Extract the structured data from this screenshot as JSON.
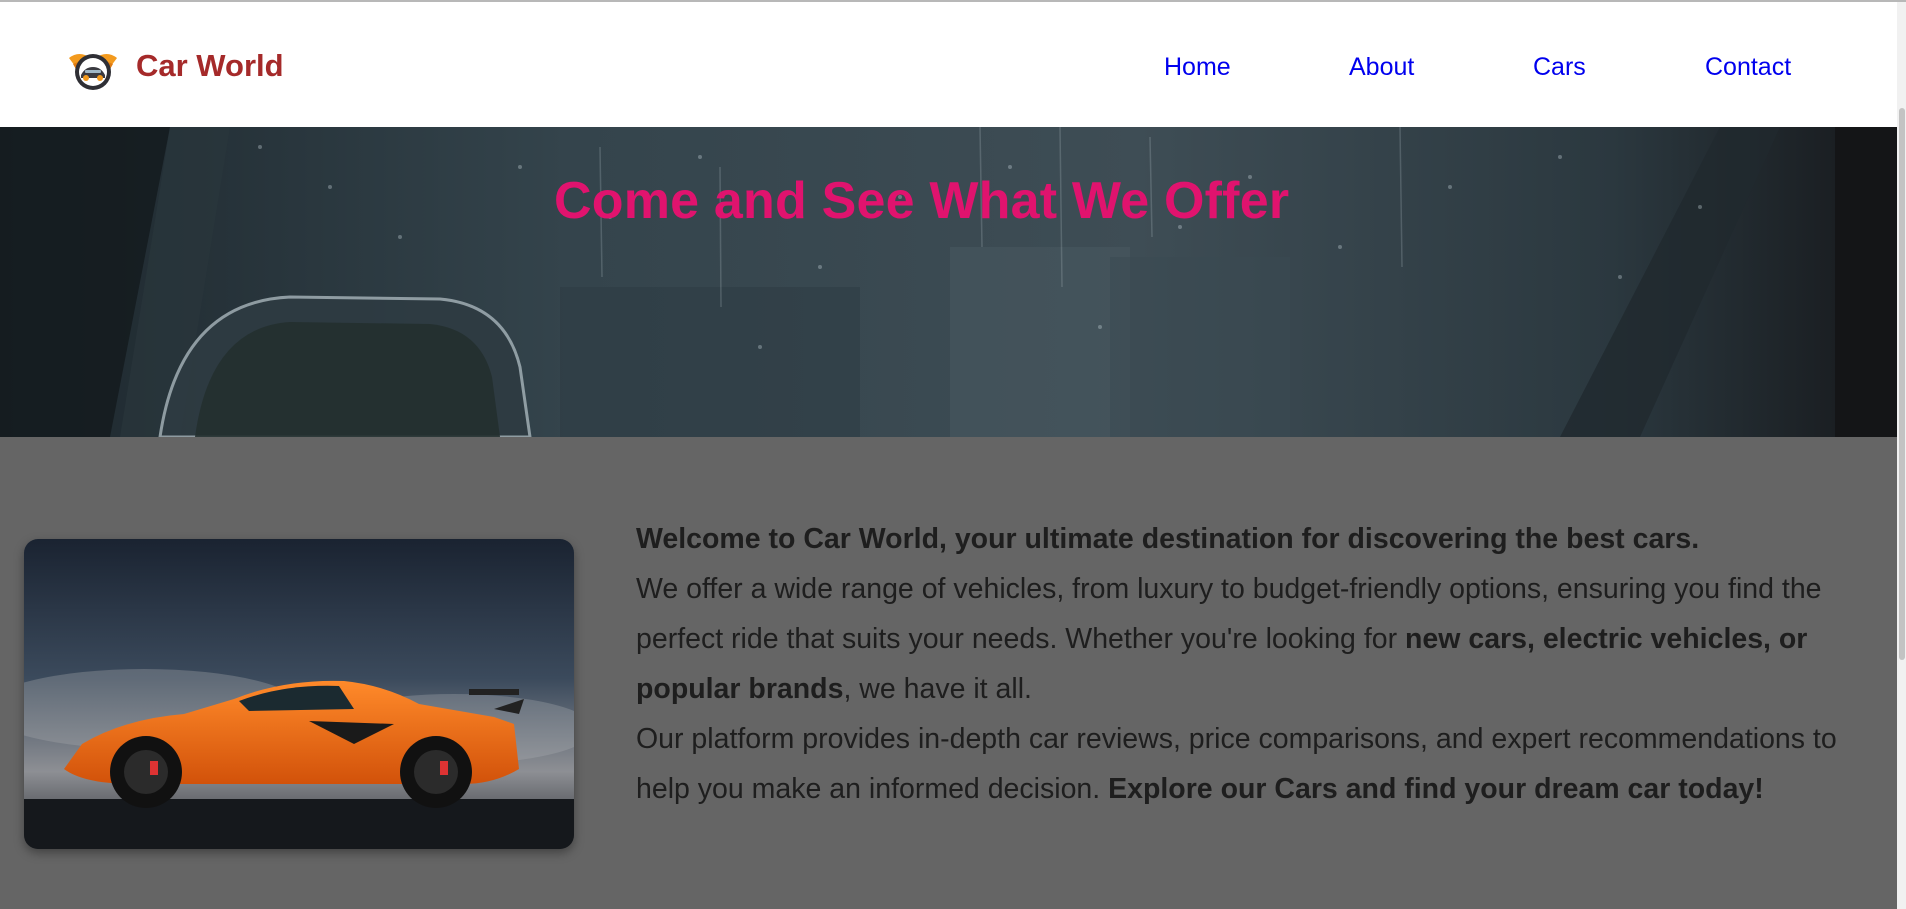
{
  "brand": {
    "name": "Car World",
    "logo_icon": "car-wings-logo-icon",
    "color": "#a52a2a"
  },
  "nav": {
    "items": [
      {
        "label": "Home"
      },
      {
        "label": "About"
      },
      {
        "label": "Cars"
      },
      {
        "label": "Contact"
      }
    ],
    "link_color": "#0000ee"
  },
  "hero": {
    "title": "Come and See What We Offer",
    "title_color": "#e0136e",
    "background": "rainy-car-window-photo"
  },
  "about": {
    "image": "orange-sports-car-photo",
    "intro": "Welcome to Car World, your ultimate destination for discovering the best cars.",
    "p1_a": "We offer a wide range of vehicles, from luxury to budget-friendly options, ensuring you find the perfect ride that suits your needs. Whether you're looking for ",
    "p1_bold": "new cars, electric vehicles, or popular brands",
    "p1_b": ", we have it all.",
    "p2_a": "Our platform provides in-depth car reviews, price comparisons, and expert recommendations to help you make an informed decision. ",
    "p2_bold": "Explore our Cars and find your dream car today!",
    "background_color": "#656565"
  }
}
